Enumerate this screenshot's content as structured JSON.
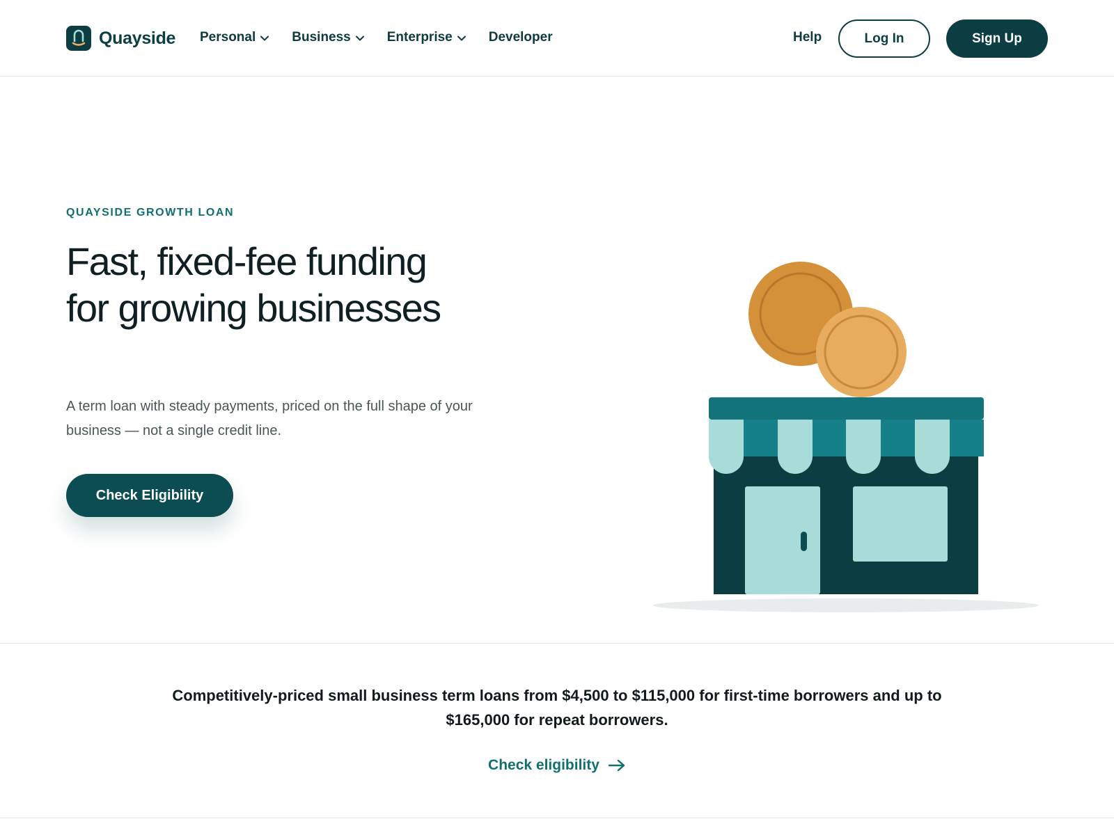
{
  "brand": {
    "name": "Quayside",
    "logo_icon": "anchor-mark-icon"
  },
  "nav": {
    "items": [
      {
        "label": "Personal",
        "has_dropdown": true
      },
      {
        "label": "Business",
        "has_dropdown": true
      },
      {
        "label": "Enterprise",
        "has_dropdown": true
      },
      {
        "label": "Developer",
        "has_dropdown": false
      }
    ],
    "help_label": "Help",
    "login_label": "Log In",
    "signup_label": "Sign Up"
  },
  "hero": {
    "eyebrow": "QUAYSIDE GROWTH LOAN",
    "headline": "Fast, fixed-fee funding for growing businesses",
    "subcopy": "A term loan with steady payments, priced on the full shape of your business — not a single credit line.",
    "cta_label": "Check Eligibility",
    "illustration": "storefront-with-coins-illustration"
  },
  "info": {
    "text": "Competitively-priced small business term loans from $4,500 to $115,000 for first-time borrowers and up to $165,000 for repeat borrowers.",
    "link_label": "Check eligibility",
    "link_icon": "arrow-right-icon"
  },
  "colors": {
    "primary": "#0b3d42",
    "accent_teal": "#11706f",
    "awning": "#12737a",
    "light_teal": "#a8dcd8",
    "coin_dark": "#d4913a",
    "coin_light": "#e8ac5e"
  }
}
